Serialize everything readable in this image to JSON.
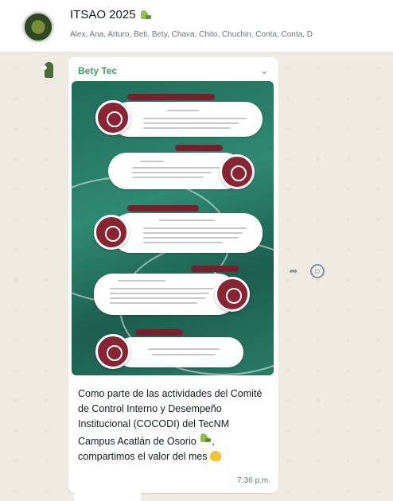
{
  "header": {
    "title": "ITSAO 2025",
    "members": "Alex, Ana, Arturo, Beti, Bety, Chava, Chito, Chuchin, Conta, Conta, D"
  },
  "message": {
    "sender": "Bety Tec",
    "caption_main": "Como parte de las actividades del Comité de Control Interno y Desempeño Institucional (COCODI) del TecNM Campus Acatlán de Osorio",
    "caption_tail": ", compartimos el valor del mes",
    "time": "7:36 p.m."
  },
  "icons": {
    "group_avatar": "group-avatar",
    "sender_avatar": "sender-avatar",
    "chevron": "chevron-down-icon",
    "forward": "forward-icon",
    "react": "emoji-react-icon"
  },
  "colors": {
    "sender_name": "#3aa35b",
    "chat_bg": "#efeae2",
    "infographic_green": "#1f6b5a",
    "infographic_maroon": "#8a2332"
  }
}
